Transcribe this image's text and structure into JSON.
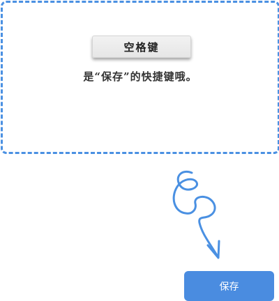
{
  "hint": {
    "key_label": "空格键",
    "text": "是“保存”的快捷键哦。"
  },
  "decoration": {
    "arrow_icon": "hand-drawn-swirl-arrow-icon",
    "color": "#4a90e2"
  },
  "actions": {
    "save_label": "保存"
  },
  "colors": {
    "accent": "#4a90e2",
    "button": "#4a8ce0"
  }
}
